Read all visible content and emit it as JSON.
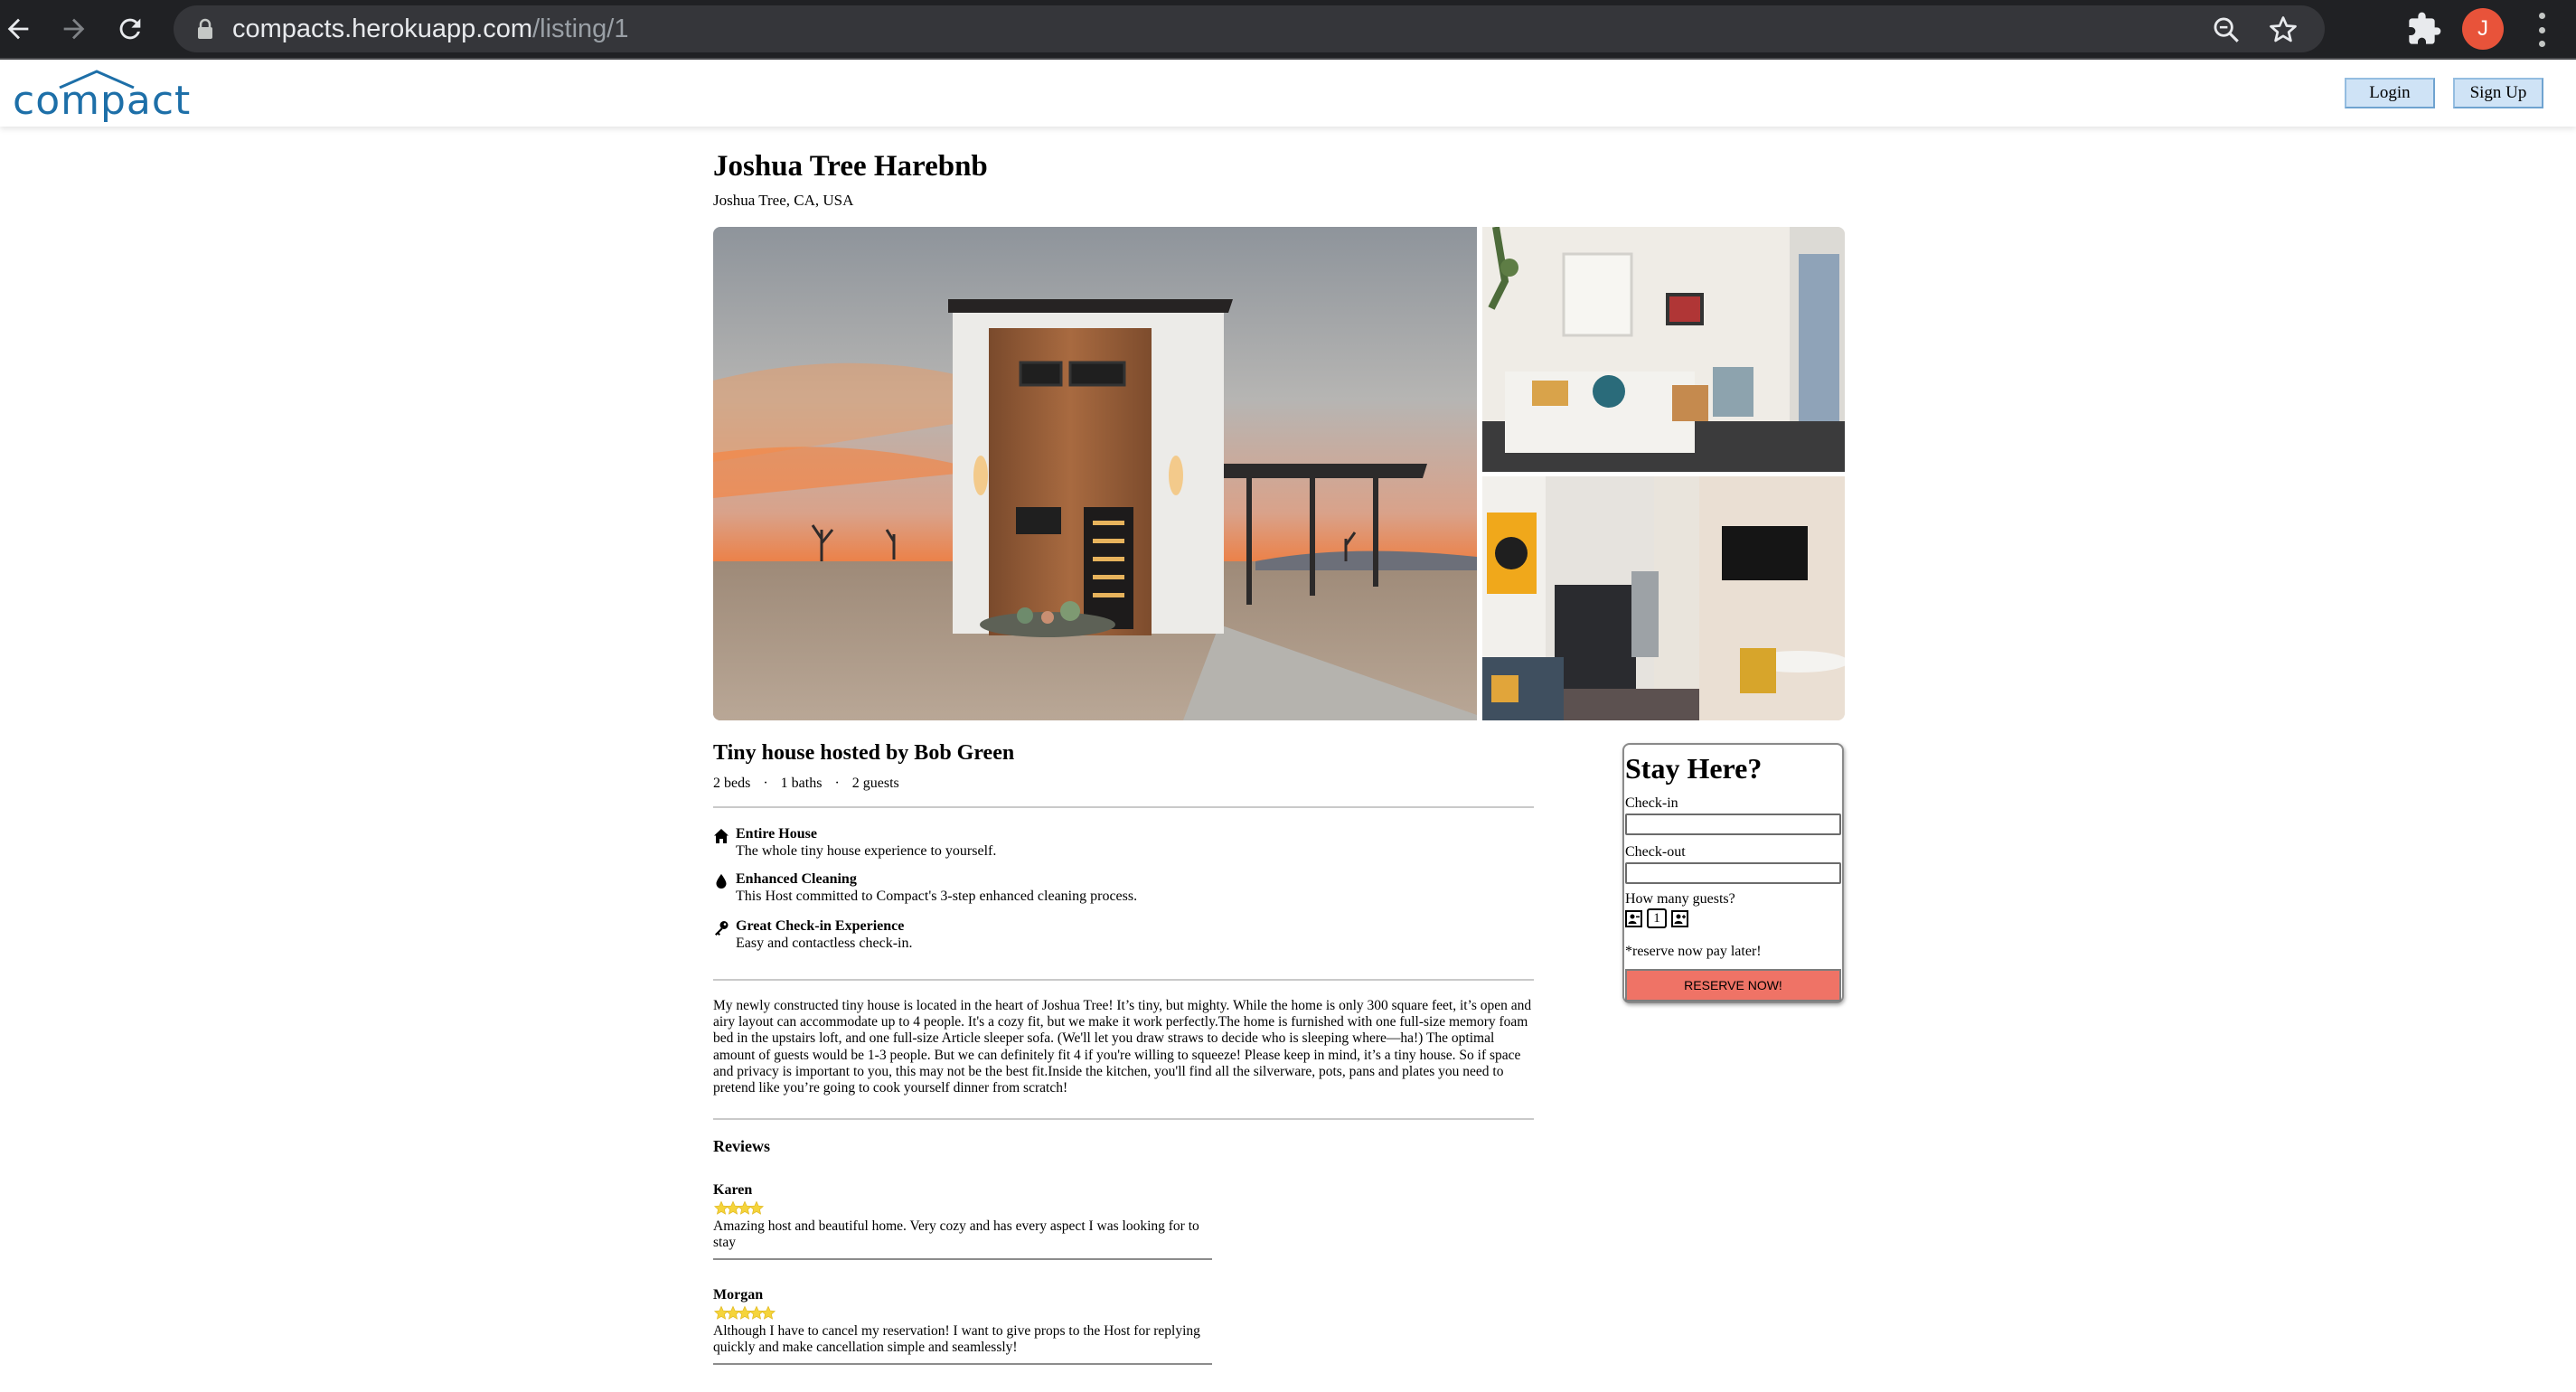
{
  "browser": {
    "url_host": "compacts.herokuapp.com",
    "url_path": "/listing/1",
    "avatar_letter": "J",
    "icons": [
      "back-icon",
      "forward-icon",
      "reload-icon",
      "lock-icon",
      "zoom-icon",
      "star-icon",
      "extensions-icon",
      "menu-icon"
    ]
  },
  "header": {
    "logo": "compact",
    "login_label": "Login",
    "signup_label": "Sign Up",
    "brand_color": "#1d6fa8"
  },
  "listing": {
    "title": "Joshua Tree Harebnb",
    "location": "Joshua Tree, CA, USA",
    "host_title": "Tiny house hosted by Bob Green",
    "stats": [
      "2 beds",
      "1 baths",
      "2 guests"
    ],
    "stat_separator": "·",
    "features": [
      {
        "icon": "home-icon",
        "name": "Entire House",
        "desc": "The whole tiny house experience to yourself."
      },
      {
        "icon": "droplet-icon",
        "name": "Enhanced Cleaning",
        "desc": "This Host committed to Compact's 3-step enhanced cleaning process."
      },
      {
        "icon": "key-icon",
        "name": "Great Check-in Experience",
        "desc": "Easy and contactless check-in."
      }
    ],
    "description": "My newly constructed tiny house is located in the heart of Joshua Tree! It’s tiny, but mighty. While the home is only 300 square feet, it’s open and airy layout can accommodate up to 4 people. It's a cozy fit, but we make it work perfectly.The home is furnished with one full-size memory foam bed in the upstairs loft, and one full-size Article sleeper sofa. (We'll let you draw straws to decide who is sleeping where—ha!) The optimal amount of guests would be 1-3 people. But we can definitely fit 4 if you're willing to squeeze! Please keep in mind, it’s a tiny house. So if space and privacy is important to you, this may not be the best fit.Inside the kitchen, you'll find all the silverware, pots, pans and plates you need to pretend like you’re going to cook yourself dinner from scratch!"
  },
  "reviews": {
    "title": "Reviews",
    "items": [
      {
        "name": "Karen",
        "rating": 4,
        "text": "Amazing host and beautiful home. Very cozy and has every aspect I was looking for to stay"
      },
      {
        "name": "Morgan",
        "rating": 5,
        "text": "Although I have to cancel my reservation! I want to give props to the Host for replying quickly and make cancellation simple and seamlessly!"
      }
    ],
    "star_color": "#f5d43b"
  },
  "booking": {
    "title": "Stay Here?",
    "checkin_label": "Check-in",
    "checkin_value": "",
    "checkout_label": "Check-out",
    "checkout_value": "",
    "guests_label": "How many guests?",
    "guest_count": "1",
    "note": "*reserve now pay later!",
    "reserve_label": "RESERVE NOW!",
    "reserve_color": "#ef7366"
  }
}
